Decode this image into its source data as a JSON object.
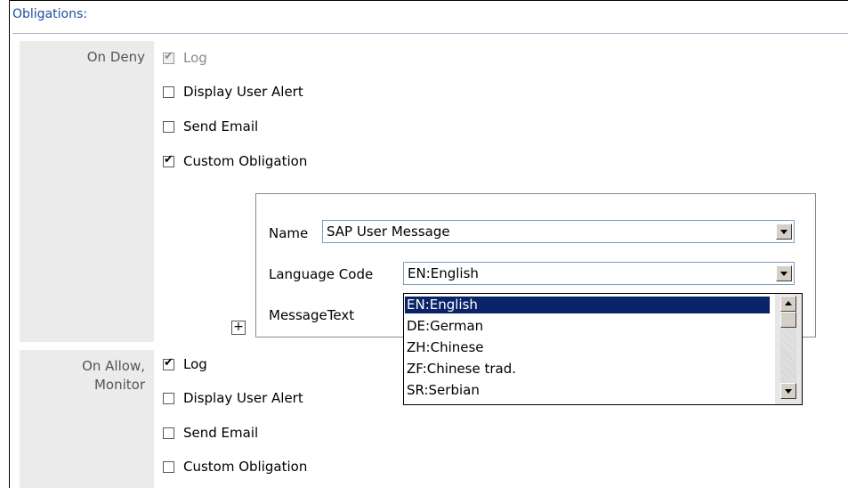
{
  "header": {
    "title": "Obligations:"
  },
  "on_deny": {
    "label": "On Deny",
    "items": [
      {
        "label": "Log",
        "checked": true,
        "disabled": true
      },
      {
        "label": "Display User Alert",
        "checked": false,
        "disabled": false
      },
      {
        "label": "Send Email",
        "checked": false,
        "disabled": false
      },
      {
        "label": "Custom Obligation",
        "checked": true,
        "disabled": false
      }
    ]
  },
  "custom_obligation": {
    "name_label": "Name",
    "name_value": "SAP User Message",
    "language_label": "Language Code",
    "language_value": "EN:English",
    "message_label": "MessageText",
    "add_button": "+",
    "language_options": [
      "EN:English",
      "DE:German",
      "ZH:Chinese",
      "ZF:Chinese trad.",
      "SR:Serbian"
    ],
    "selected_option": "EN:English"
  },
  "on_allow": {
    "label_line1": "On Allow,",
    "label_line2": "Monitor",
    "items": [
      {
        "label": "Log",
        "checked": true,
        "disabled": false
      },
      {
        "label": "Display User Alert",
        "checked": false,
        "disabled": false
      },
      {
        "label": "Send Email",
        "checked": false,
        "disabled": false
      },
      {
        "label": "Custom Obligation",
        "checked": false,
        "disabled": false
      }
    ]
  },
  "icons": {
    "dropdown": "chevron-down-icon",
    "scroll_up": "scroll-up-icon",
    "scroll_down": "scroll-down-icon",
    "add": "plus-icon"
  }
}
